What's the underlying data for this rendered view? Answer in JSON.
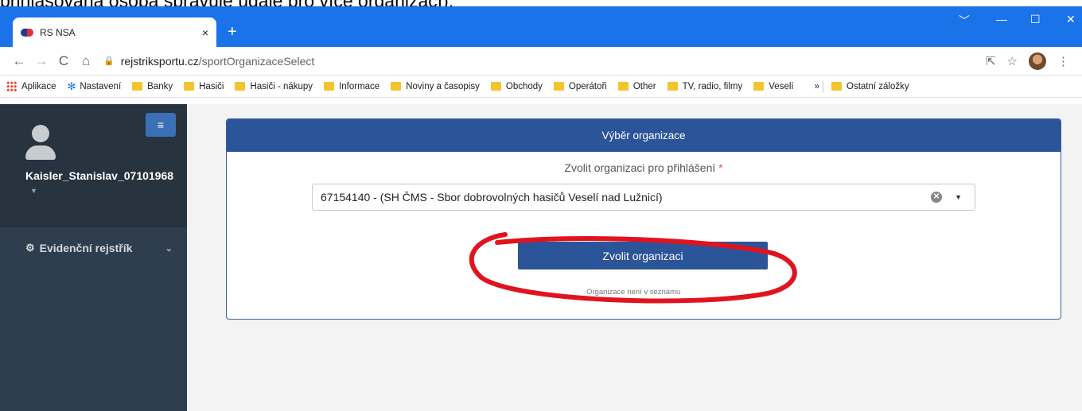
{
  "caption": "přihlašovaná osoba spravuje údaje pro více organizací).",
  "browser": {
    "tab_title": "RS NSA",
    "tab_close": "×",
    "new_tab": "+",
    "url_host": "rejstriksportu.cz",
    "url_path": "/sportOrganizaceSelect",
    "window_controls": [
      "﹀",
      "—",
      "☐",
      "✕"
    ]
  },
  "bookmarks": {
    "apps": "Aplikace",
    "settings": "Nastavení",
    "folders": [
      "Banky",
      "Hasiči",
      "Hasiči - nákupy",
      "Informace",
      "Noviny a časopisy",
      "Obchody",
      "Operátoři",
      "Other",
      "TV, radio, filmy",
      "Veselí"
    ],
    "more": "»",
    "other": "Ostatní záložky"
  },
  "sidebar": {
    "menu_toggle": "≡",
    "username": "Kaisler_Stanislav_07101968",
    "caret": "▼",
    "nav_item": "Evidenční rejstřík",
    "nav_chevron": "⌄"
  },
  "card": {
    "header": "Výběr organizace",
    "field_label": "Zvolit organizaci pro přihlášení",
    "required_mark": "*",
    "selected_value": "67154140 - (SH ČMS - Sbor dobrovolných hasičů Veselí nad Lužnicí)",
    "clear": "✕",
    "dropdown": "▼",
    "button": "Zvolit organizaci",
    "footnote": "Organizace není v seznamu"
  },
  "colors": {
    "browser_accent": "#1a73e8",
    "sidebar": "#2f3e4e",
    "primary": "#2b5499",
    "annotation": "#e0141e"
  }
}
